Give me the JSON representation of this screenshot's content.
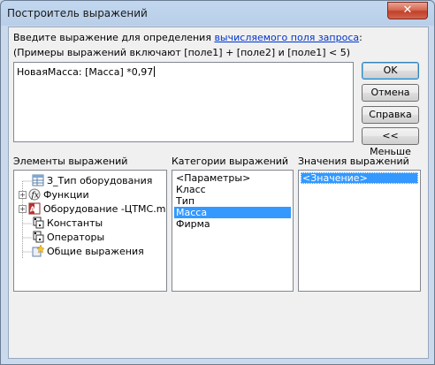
{
  "window": {
    "title": "Построитель выражений",
    "close_glyph": "✕"
  },
  "instructions": {
    "line1_prefix": "Введите выражение для определения ",
    "line1_link": "вычисляемого поля запроса",
    "line1_suffix": ":",
    "line2": "(Примеры выражений включают [поле1] + [поле2] и [поле1] < 5)"
  },
  "expression": {
    "value": "НоваяМасса: [Масса] *0,97"
  },
  "buttons": {
    "ok": "OK",
    "cancel": "Отмена",
    "help": "Справка",
    "less": "<< Меньше"
  },
  "sections": {
    "elements_label": "Элементы выражений",
    "categories_label": "Категории выражений",
    "values_label": "Значения выражений"
  },
  "elements_tree": [
    {
      "label": "З_Тип оборудования",
      "icon": "query-icon",
      "expandable": false,
      "selected": true
    },
    {
      "label": "Функции",
      "icon": "function-icon",
      "expandable": true
    },
    {
      "label": "Оборудование -ЦТМС.md",
      "icon": "database-icon",
      "expandable": true
    },
    {
      "label": "Константы",
      "icon": "constants-icon",
      "expandable": false
    },
    {
      "label": "Операторы",
      "icon": "operators-icon",
      "expandable": false
    },
    {
      "label": "Общие выражения",
      "icon": "common-expressions-icon",
      "expandable": false
    }
  ],
  "categories": [
    {
      "label": "<Параметры>",
      "selected": false
    },
    {
      "label": "Класс",
      "selected": false
    },
    {
      "label": "Тип",
      "selected": false
    },
    {
      "label": "Масса",
      "selected": true
    },
    {
      "label": "Фирма",
      "selected": false
    }
  ],
  "values": [
    {
      "label": "<Значение>",
      "selected": true
    }
  ],
  "colors": {
    "selection": "#3399ff",
    "link": "#0033cc",
    "close": "#c2402a"
  }
}
